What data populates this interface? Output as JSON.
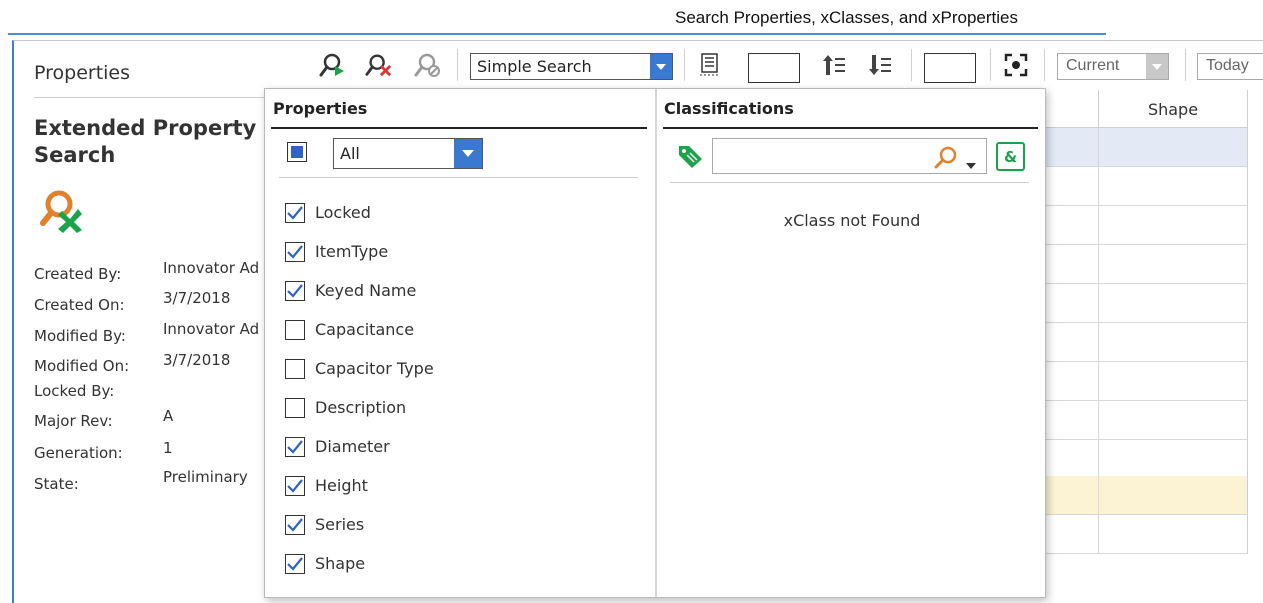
{
  "caption": "Search Properties, xClasses, and xProperties",
  "sidebar": {
    "title": "Properties",
    "heading": "Extended Property Search",
    "fields": [
      {
        "label": "Created By:",
        "value": "Innovator Ad"
      },
      {
        "label": "Created On:",
        "value": "3/7/2018"
      },
      {
        "label": "Modified By:",
        "value": "Innovator Ad"
      },
      {
        "label": "Modified On:",
        "value": "3/7/2018"
      },
      {
        "label": "Locked By:",
        "value": ""
      },
      {
        "label": "Major Rev:",
        "value": "A"
      },
      {
        "label": "Generation:",
        "value": "1"
      },
      {
        "label": "State:",
        "value": "Preliminary"
      }
    ]
  },
  "toolbar": {
    "search_mode": "Simple Search",
    "revision": "Current",
    "date": "Today"
  },
  "grid": {
    "shape_header": "Shape",
    "rows": [
      "selected",
      "normal",
      "normal",
      "normal",
      "normal",
      "normal",
      "normal",
      "normal",
      "normal",
      "highlight",
      "normal"
    ]
  },
  "properties_pane": {
    "title": "Properties",
    "filter_value": "All",
    "items": [
      {
        "label": "Locked",
        "checked": true
      },
      {
        "label": "ItemType",
        "checked": true
      },
      {
        "label": "Keyed Name",
        "checked": true
      },
      {
        "label": "Capacitance",
        "checked": false
      },
      {
        "label": "Capacitor Type",
        "checked": false
      },
      {
        "label": "Description",
        "checked": false
      },
      {
        "label": "Diameter",
        "checked": true
      },
      {
        "label": "Height",
        "checked": true
      },
      {
        "label": "Series",
        "checked": true
      },
      {
        "label": "Shape",
        "checked": true
      }
    ]
  },
  "classifications_pane": {
    "title": "Classifications",
    "search_value": "",
    "empty_message": "xClass not Found"
  },
  "colors": {
    "accent_blue": "#3a79d1",
    "green": "#1aa34a",
    "orange": "#e0812b",
    "selected_row": "#e3eaf6",
    "highlight_row": "#fbf3d3"
  }
}
